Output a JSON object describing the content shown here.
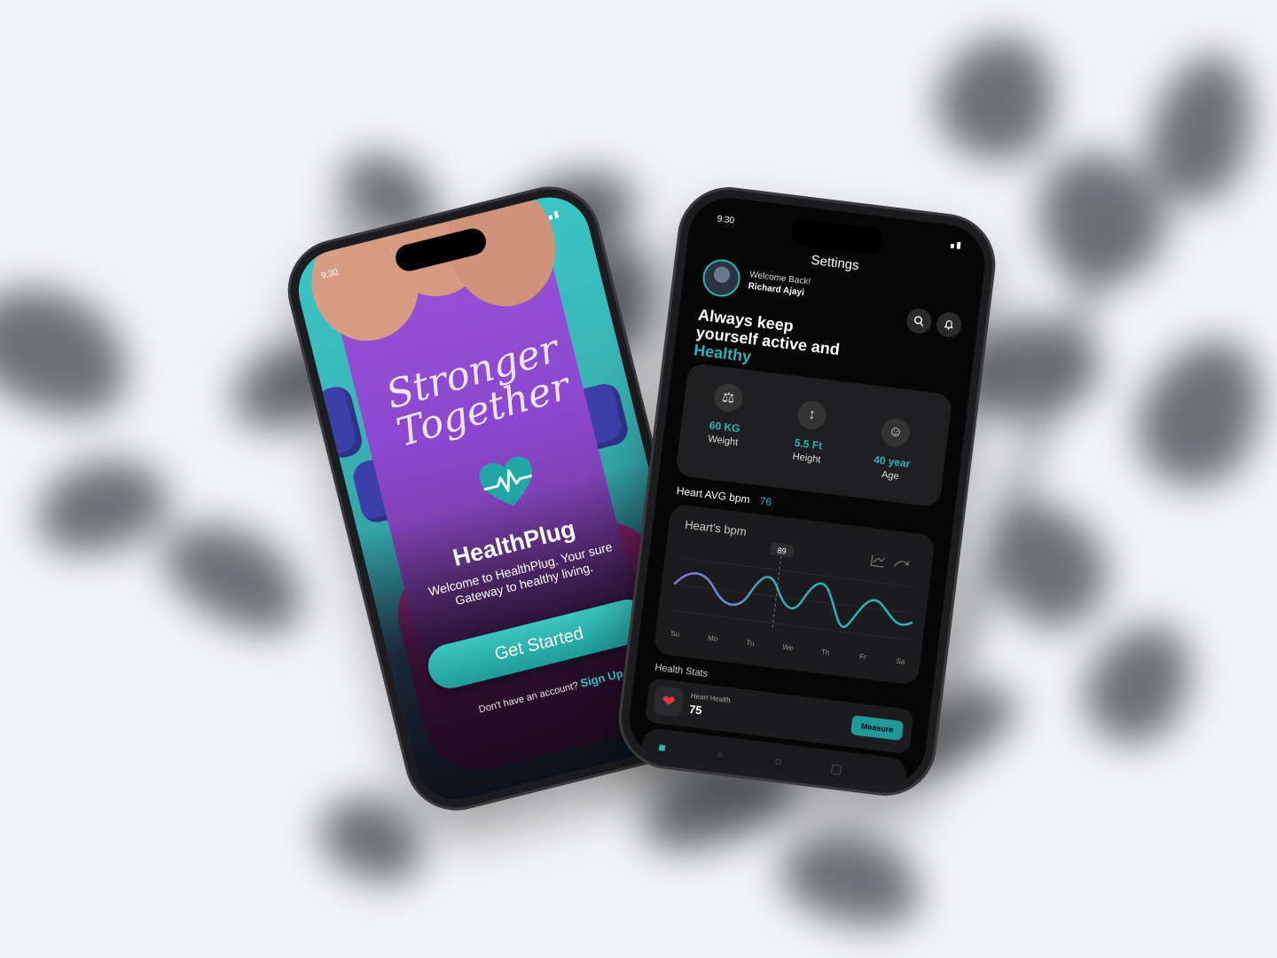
{
  "left_phone": {
    "status_time": "9:30",
    "hero_text": "Stronger Together",
    "app_name": "HealthPlug",
    "subtitle": "Welcome to HealthPlug. Your sure Gateway to healthy living.",
    "cta_label": "Get Started",
    "account_prompt": "Don't have an account?",
    "signup_label": "Sign Up",
    "colors": {
      "accent": "#35c8c4",
      "purple": "#8b47cf"
    }
  },
  "right_phone": {
    "status_time": "9:30",
    "title": "Settings",
    "welcome": "Welcome Back!",
    "user_name": "Richard Ajayi",
    "headline_line1": "Always keep",
    "headline_line2": "yourself active and",
    "headline_accent": "Healthy",
    "stats": [
      {
        "value": "60 KG",
        "label": "Weight",
        "icon": "scale-icon"
      },
      {
        "value": "5.5 Ft",
        "label": "Height",
        "icon": "height-icon"
      },
      {
        "value": "40 year",
        "label": "Age",
        "icon": "age-icon"
      }
    ],
    "avg_label": "Heart AVG bpm",
    "avg_value": "76",
    "chart_title": "Heart's bpm",
    "chart_tooltip": "89",
    "days": [
      "Su",
      "Mo",
      "Tu",
      "We",
      "Th",
      "Fr",
      "Sa"
    ],
    "health_stats_title": "Health Stats",
    "health_label": "Heart Health",
    "health_value": "75",
    "measure_label": "Measure",
    "colors": {
      "accent": "#2ab3b5",
      "background": "#060606"
    }
  }
}
